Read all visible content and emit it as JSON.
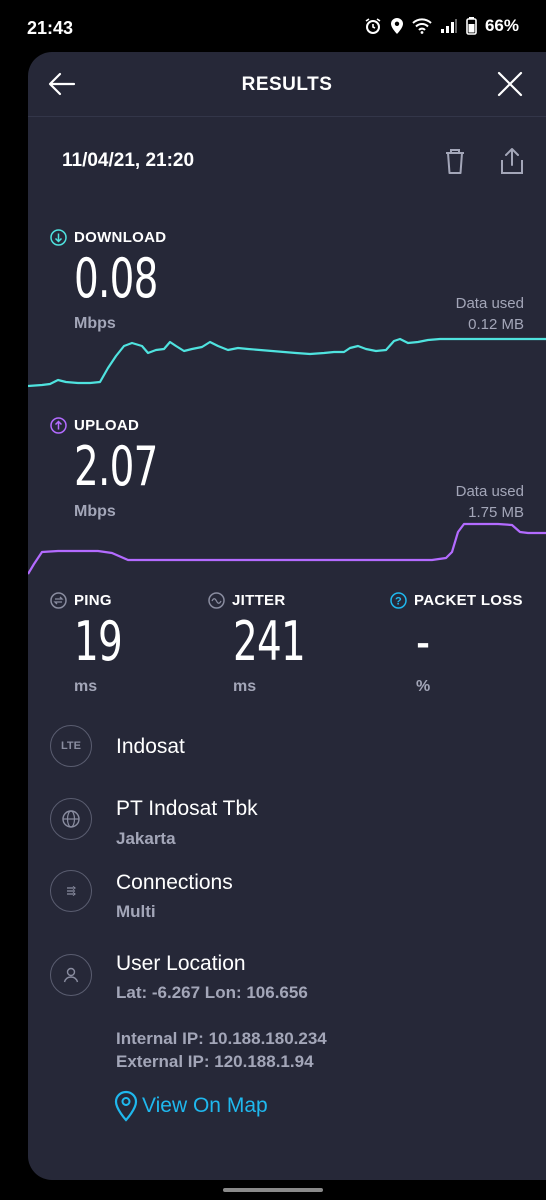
{
  "status_bar": {
    "time": "21:43",
    "battery": "66%"
  },
  "header": {
    "title": "RESULTS"
  },
  "result": {
    "datetime": "11/04/21, 21:20"
  },
  "download": {
    "label": "DOWNLOAD",
    "value": "0.08",
    "unit": "Mbps",
    "data_used_label": "Data used",
    "data_used_value": "0.12 MB",
    "color": "#4fe3df"
  },
  "upload": {
    "label": "UPLOAD",
    "value": "2.07",
    "unit": "Mbps",
    "data_used_label": "Data used",
    "data_used_value": "1.75 MB",
    "color": "#b36bff"
  },
  "ping": {
    "label": "PING",
    "value": "19",
    "unit": "ms"
  },
  "jitter": {
    "label": "JITTER",
    "value": "241",
    "unit": "ms"
  },
  "packet_loss": {
    "label": "PACKET LOSS",
    "value": "-",
    "unit": "%"
  },
  "info": {
    "carrier": {
      "icon_text": "LTE",
      "name": "Indosat"
    },
    "provider": {
      "name": "PT Indosat Tbk",
      "city": "Jakarta"
    },
    "connections": {
      "title": "Connections",
      "value": "Multi"
    },
    "location": {
      "title": "User Location",
      "coords": "Lat: -6.267 Lon: 106.656",
      "internal_ip": "Internal IP: 10.188.180.234",
      "external_ip": "External IP: 120.188.1.94"
    }
  },
  "map_link": {
    "label": "View On Map",
    "color": "#1fb8ee"
  }
}
